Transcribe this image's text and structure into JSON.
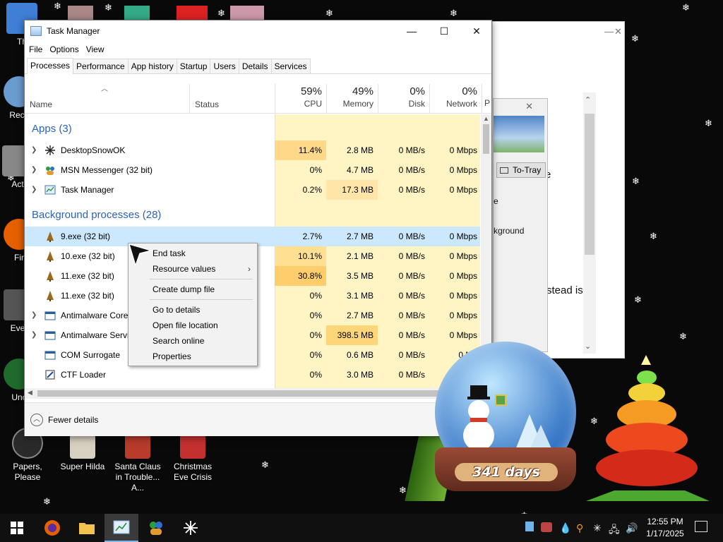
{
  "desktop": {
    "icons": [
      {
        "label": "Th",
        "color": "#3f7fd6"
      },
      {
        "label": "Recy",
        "color": "#6a9bd1"
      },
      {
        "label": "Act",
        "color": "#888888"
      },
      {
        "label": "Fir",
        "color": "#e66000"
      },
      {
        "label": "Ever",
        "color": "#555555"
      },
      {
        "label": "Unc",
        "color": "#1e6b2c"
      },
      {
        "label": "Papers, Please",
        "color": "#2a2a2a"
      },
      {
        "label": "Super Hilda",
        "color": "#d8d0c0"
      },
      {
        "label": "Santa Claus in Trouble... A...",
        "color": "#b83b2c"
      },
      {
        "label": "Christmas Eve Crisis",
        "color": "#c43030"
      }
    ],
    "globe_days": "341 days"
  },
  "bg_window": {
    "fragments": [
      "e",
      "stead is"
    ],
    "inner": {
      "to_tray": "To-Tray",
      "frag1": "e",
      "frag2": "kground"
    }
  },
  "task_manager": {
    "title": "Task Manager",
    "menu": [
      "File",
      "Options",
      "View"
    ],
    "tabs": [
      "Processes",
      "Performance",
      "App history",
      "Startup",
      "Users",
      "Details",
      "Services"
    ],
    "columns": {
      "name": "Name",
      "status": "Status",
      "cpu": {
        "pct": "59%",
        "label": "CPU"
      },
      "memory": {
        "pct": "49%",
        "label": "Memory"
      },
      "disk": {
        "pct": "0%",
        "label": "Disk"
      },
      "network": {
        "pct": "0%",
        "label": "Network"
      },
      "extra": "P"
    },
    "groups": {
      "apps": "Apps (3)",
      "background": "Background processes (28)"
    },
    "apps": [
      {
        "name": "DesktopSnowOK",
        "cpu": "11.4%",
        "memory": "2.8 MB",
        "disk": "0 MB/s",
        "network": "0 Mbps",
        "expand": true
      },
      {
        "name": "MSN Messenger (32 bit)",
        "cpu": "0%",
        "memory": "4.7 MB",
        "disk": "0 MB/s",
        "network": "0 Mbps",
        "expand": true
      },
      {
        "name": "Task Manager",
        "cpu": "0.2%",
        "memory": "17.3 MB",
        "disk": "0 MB/s",
        "network": "0 Mbps",
        "expand": true
      }
    ],
    "background": [
      {
        "name": "9.exe (32 bit)",
        "cpu": "2.7%",
        "memory": "2.7 MB",
        "disk": "0 MB/s",
        "network": "0 Mbps",
        "expand": false
      },
      {
        "name": "10.exe (32 bit)",
        "cpu": "10.1%",
        "memory": "2.1 MB",
        "disk": "0 MB/s",
        "network": "0 Mbps",
        "expand": false
      },
      {
        "name": "11.exe (32 bit)",
        "cpu": "30.8%",
        "memory": "3.5 MB",
        "disk": "0 MB/s",
        "network": "0 Mbps",
        "expand": false
      },
      {
        "name": "11.exe (32 bit)",
        "cpu": "0%",
        "memory": "3.1 MB",
        "disk": "0 MB/s",
        "network": "0 Mbps",
        "expand": false
      },
      {
        "name": "Antimalware Core",
        "cpu": "0%",
        "memory": "2.7 MB",
        "disk": "0 MB/s",
        "network": "0 Mbps",
        "expand": true
      },
      {
        "name": "Antimalware Servi",
        "cpu": "0%",
        "memory": "398.5 MB",
        "disk": "0 MB/s",
        "network": "0 Mbps",
        "expand": true
      },
      {
        "name": "COM Surrogate",
        "cpu": "0%",
        "memory": "0.6 MB",
        "disk": "0 MB/s",
        "network": "0 Mb",
        "expand": false
      },
      {
        "name": "CTF Loader",
        "cpu": "0%",
        "memory": "3.0 MB",
        "disk": "0 MB/s",
        "network": "0 Mbps",
        "expand": false
      }
    ],
    "footer": {
      "fewer_details": "Fewer details"
    },
    "context_menu": {
      "end_task": "End task",
      "resource_values": "Resource values",
      "create_dump": "Create dump file",
      "go_to_details": "Go to details",
      "open_location": "Open file location",
      "search_online": "Search online",
      "properties": "Properties"
    }
  },
  "taskbar": {
    "time": "12:55 PM",
    "date": "1/17/2025"
  },
  "colors": {
    "cpu_low": "#fff4c4",
    "cpu_mid": "#ffe29a",
    "cpu_high": "#ffd373",
    "mem_high": "#ffd57a",
    "selected": "#cce8ff",
    "group_text": "#2b63b8"
  }
}
